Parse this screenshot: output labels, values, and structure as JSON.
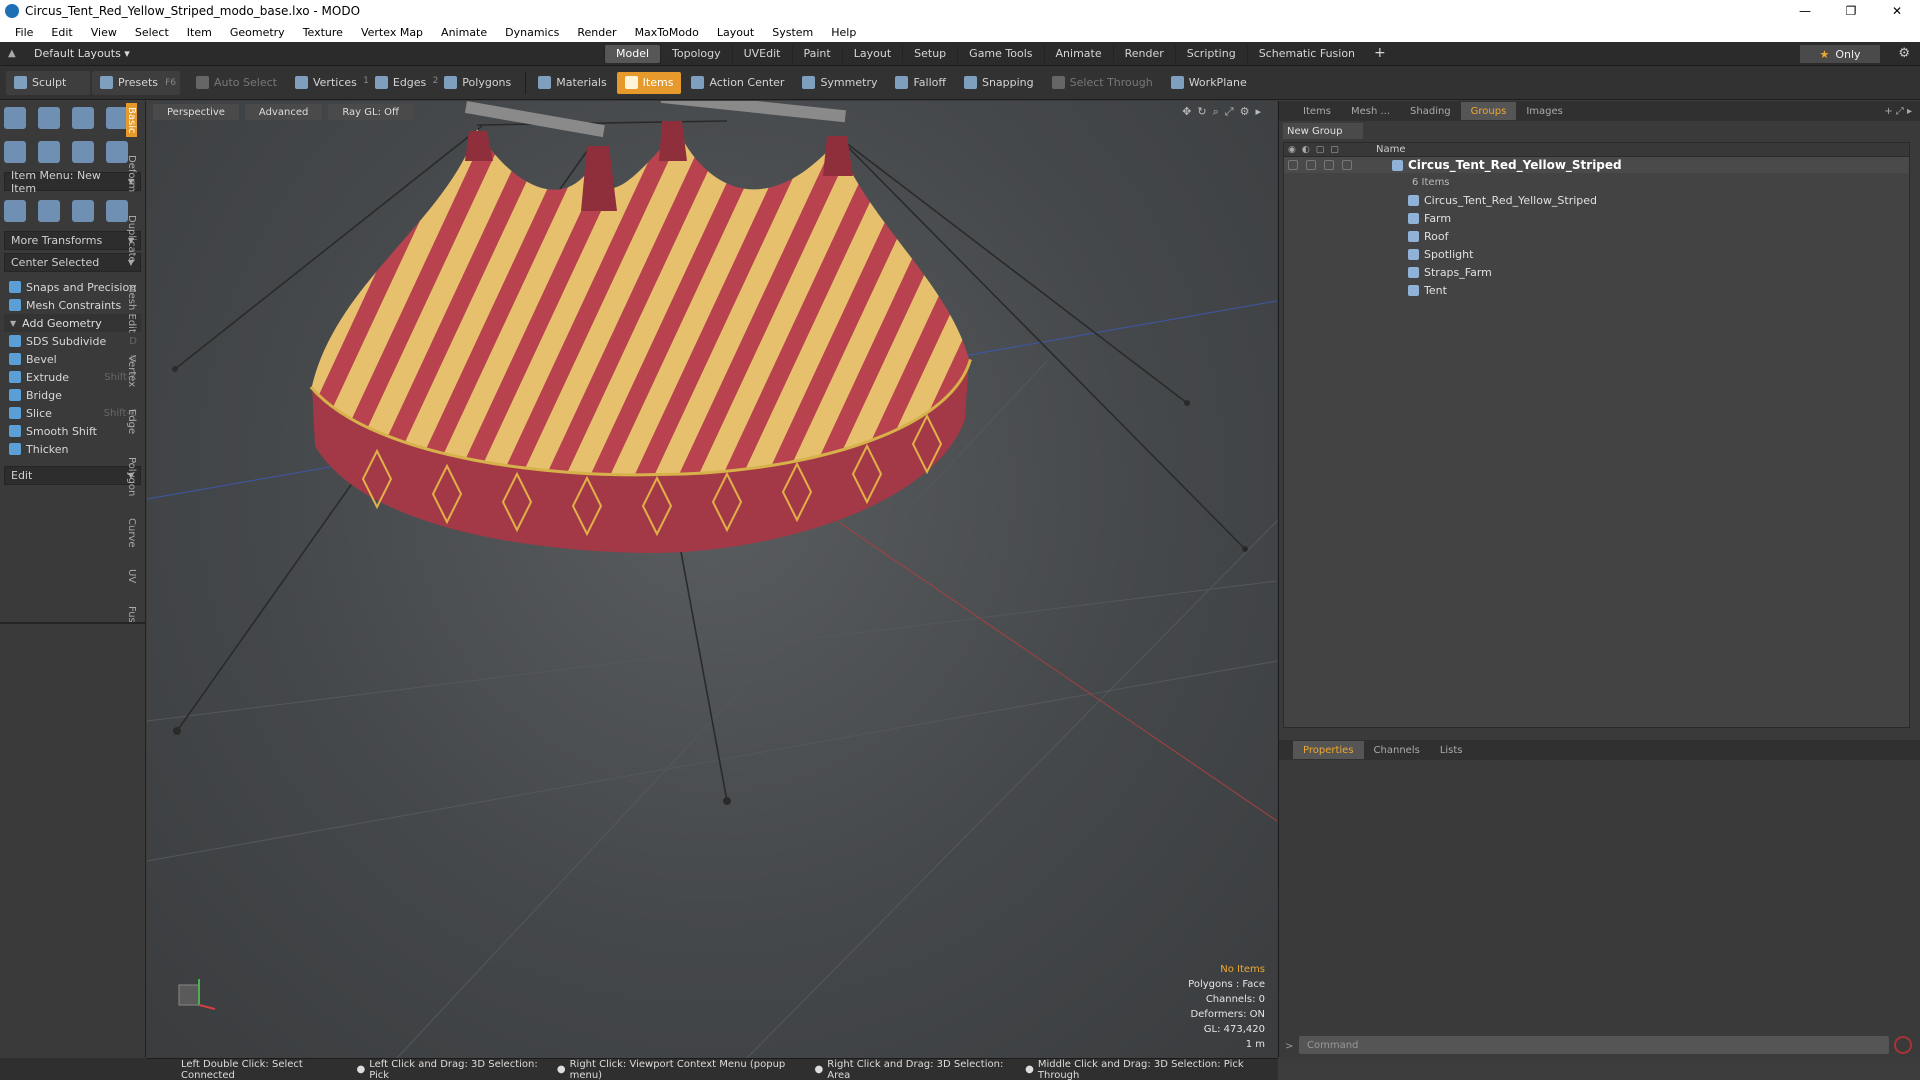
{
  "window": {
    "title": "Circus_Tent_Red_Yellow_Striped_modo_base.lxo - MODO",
    "controls": [
      "—",
      "❐",
      "✕"
    ]
  },
  "menu": [
    "File",
    "Edit",
    "View",
    "Select",
    "Item",
    "Geometry",
    "Texture",
    "Vertex Map",
    "Animate",
    "Dynamics",
    "Render",
    "MaxToModo",
    "Layout",
    "System",
    "Help"
  ],
  "layoutbar": {
    "layout_label": "Default Layouts ▾",
    "tabs": [
      "Model",
      "Topology",
      "UVEdit",
      "Paint",
      "Layout",
      "Setup",
      "Game Tools",
      "Animate",
      "Render",
      "Scripting",
      "Schematic Fusion"
    ],
    "active_tab": "Model",
    "add": "+",
    "only_label": "Only",
    "star": "★",
    "gear": "⚙"
  },
  "toolbar": {
    "sculpt": "Sculpt",
    "presets": "Presets",
    "presets_key": "F6",
    "auto_select": "Auto Select",
    "vertices": "Vertices",
    "vertices_count": "1",
    "edges": "Edges",
    "edges_count": "2",
    "polygons": "Polygons",
    "materials": "Materials",
    "items": "Items",
    "action_center": "Action Center",
    "symmetry": "Symmetry",
    "falloff": "Falloff",
    "snapping": "Snapping",
    "select_through": "Select Through",
    "workplane": "WorkPlane"
  },
  "leftpanel": {
    "item_menu": "Item Menu: New Item",
    "more_transforms": "More Transforms",
    "center_selected": "Center Selected",
    "snaps": "Snaps and Precision",
    "mesh_constraints": "Mesh Constraints",
    "add_geometry": "Add Geometry",
    "tools": [
      {
        "label": "SDS Subdivide",
        "key": "D"
      },
      {
        "label": "Bevel",
        "key": "B"
      },
      {
        "label": "Extrude",
        "key": "Shift-X"
      },
      {
        "label": "Bridge",
        "key": ""
      },
      {
        "label": "Slice",
        "key": "Shift-C"
      },
      {
        "label": "Smooth Shift",
        "key": ""
      },
      {
        "label": "Thicken",
        "key": ""
      }
    ],
    "edit": "Edit",
    "sidetabs": [
      "Basic",
      "Deform",
      "Duplicate",
      "Mesh Edit",
      "Vertex",
      "Edge",
      "Polygon",
      "Curve",
      "UV",
      "Fusion"
    ]
  },
  "viewport": {
    "perspective": "Perspective",
    "advanced": "Advanced",
    "raygl": "Ray GL: Off",
    "info": {
      "no_items": "No Items",
      "polygons": "Polygons : Face",
      "channels": "Channels: 0",
      "deformers": "Deformers: ON",
      "gl": "GL: 473,420",
      "scale": "1 m"
    }
  },
  "rightpanel": {
    "tabs": [
      "Items",
      "Mesh ...",
      "Shading",
      "Groups",
      "Images"
    ],
    "active_tab": "Groups",
    "new_group": "New Group",
    "name_col": "Name",
    "root": "Circus_Tent_Red_Yellow_Striped",
    "root_count": "6 Items",
    "children": [
      "Circus_Tent_Red_Yellow_Striped",
      "Farm",
      "Roof",
      "Spotlight",
      "Straps_Farm",
      "Tent"
    ],
    "lower_tabs": [
      "Properties",
      "Channels",
      "Lists"
    ],
    "lower_active": "Properties",
    "command_placeholder": "Command"
  },
  "statusbar": [
    "Left Double Click: Select Connected",
    "Left Click and Drag: 3D Selection: Pick",
    "Right Click: Viewport Context Menu (popup menu)",
    "Right Click and Drag: 3D Selection: Area",
    "Middle Click and Drag: 3D Selection: Pick Through"
  ],
  "colors": {
    "accent": "#e69a2c",
    "tent_red": "#b8434f",
    "tent_yellow": "#e6c06c"
  }
}
